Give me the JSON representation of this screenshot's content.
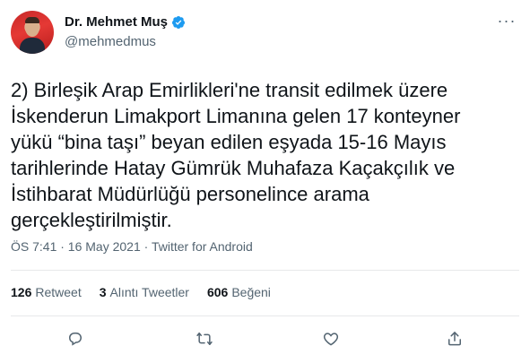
{
  "author": {
    "display_name": "Dr. Mehmet Muş",
    "handle": "@mehmedmus",
    "avatar_icon": "profile-photo",
    "verified_icon": "verified-badge-icon",
    "verified_color": "#1d9bf0"
  },
  "tweet": {
    "lines": [
      "2) Birleşik Arap Emirlikleri'ne transit edilmek üzere",
      "İskenderun Limakport Limanına gelen 17 konteyner",
      "yükü “bina taşı” beyan edilen eşyada 15-16 Mayıs",
      "tarihlerinde Hatay Gümrük Muhafaza Kaçakçılık ve",
      "İstihbarat Müdürlüğü personelince arama",
      "gerçekleştirilmiştir."
    ],
    "timestamp": "ÖS 7:41 · 16 May 2021 · Twitter for Android"
  },
  "stats": {
    "retweets_count": "126",
    "retweets_label": "Retweet",
    "quotes_count": "3",
    "quotes_label": "Alıntı Tweetler",
    "likes_count": "606",
    "likes_label": "Beğeni"
  },
  "actions": {
    "reply_icon": "reply-icon",
    "retweet_icon": "retweet-icon",
    "like_icon": "like-icon",
    "share_icon": "share-icon"
  },
  "colors": {
    "text_primary": "#0f1419",
    "text_secondary": "#536471",
    "divider": "#e7e9ea",
    "verified": "#1d9bf0"
  }
}
